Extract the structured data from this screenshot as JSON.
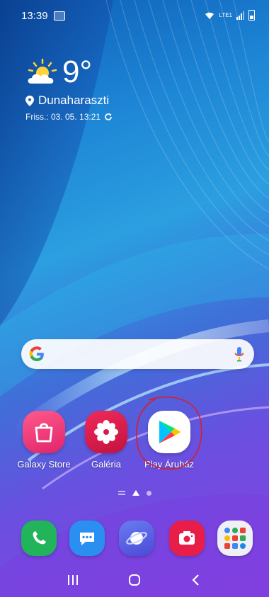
{
  "status_bar": {
    "time": "13:39",
    "network_label": "VoLTE1",
    "lte_label": "LTE1"
  },
  "weather": {
    "temperature": "9°",
    "location": "Dunaharaszti",
    "updated": "Friss.: 03. 05. 13:21"
  },
  "search_bar": {
    "logo": "G"
  },
  "apps": [
    {
      "label": "Galaxy Store",
      "icon": "galaxy-store-icon",
      "color": "#e8356c"
    },
    {
      "label": "Galéria",
      "icon": "gallery-icon",
      "color": "#d81b4a"
    },
    {
      "label": "Play Áruház",
      "icon": "play-store-icon",
      "color": "#ffffff"
    }
  ],
  "highlight_color": "#d81e2a",
  "dock": [
    {
      "icon": "phone-icon",
      "color": "#22b45a"
    },
    {
      "icon": "messages-icon",
      "color": "#2a8ff0"
    },
    {
      "icon": "internet-icon",
      "color": "#5868e8"
    },
    {
      "icon": "camera-icon",
      "color": "#e81e48"
    },
    {
      "icon": "google-folder-icon",
      "color": "#eef0f5"
    }
  ],
  "nav": {
    "recent": "recent-apps-icon",
    "home": "home-icon",
    "back": "back-icon"
  }
}
